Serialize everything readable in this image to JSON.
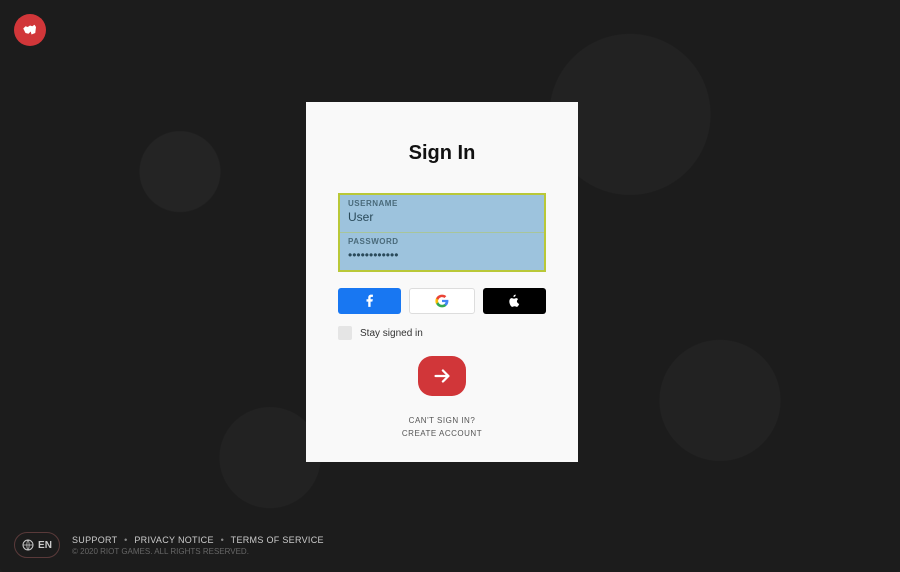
{
  "brand": {
    "logo_name": "riot-fist"
  },
  "signin": {
    "title": "Sign In",
    "username_label": "USERNAME",
    "username_value": "User",
    "password_label": "PASSWORD",
    "password_value": "••••••••••••",
    "stay_signed_in_label": "Stay signed in",
    "cant_sign_in": "CAN'T SIGN IN?",
    "create_account": "CREATE ACCOUNT"
  },
  "social": {
    "facebook": "facebook",
    "google": "google",
    "apple": "apple"
  },
  "footer": {
    "lang": "EN",
    "support": "SUPPORT",
    "privacy": "PRIVACY NOTICE",
    "terms": "TERMS OF SERVICE",
    "sep": "•",
    "copyright": "© 2020 RIOT GAMES. ALL RIGHTS RESERVED."
  },
  "colors": {
    "accent": "#d13639",
    "input_border": "#b9c838",
    "input_bg": "#9dc3dd"
  }
}
